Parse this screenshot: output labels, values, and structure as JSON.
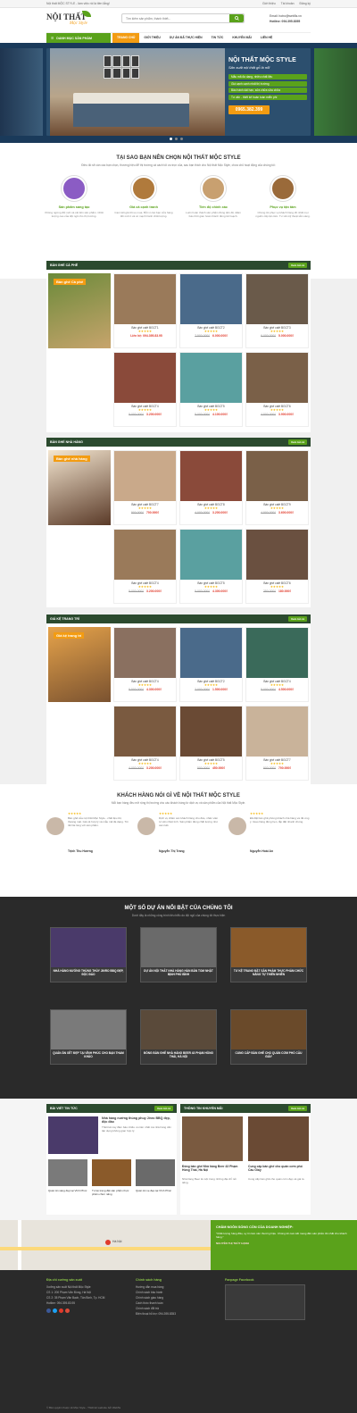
{
  "topbar": {
    "left": "Nội thất MỘC STYLE - làm việc rồi là tiền lắng!",
    "links": [
      "Giới thiệu",
      "Tài khoản",
      "Đăng ký"
    ]
  },
  "header": {
    "logo_text": "NỘI THẤT",
    "logo_sub": "Mộc Style",
    "search_placeholder": "Tìm kiếm sản phẩm, thành thiết...",
    "email": "Email: hotro@web5s.vn",
    "hotline": "Hotline: 094.395.8395"
  },
  "nav": {
    "category": "DANH MỤC SẢN PHẨM",
    "items": [
      "TRANG CHỦ",
      "GIỚI THIỆU",
      "DỰ ÁN ĐÃ THỰC HIỆN",
      "TIN TỨC",
      "KHUYẾN MÃI",
      "LIÊN HỆ"
    ]
  },
  "hero": {
    "title": "NỘI THẤT MỘC STYLE",
    "subtitle": "Sản xuất nội thất gỗ lồ nổi",
    "bullets": [
      "Mẫu mã đa dạng, nhiều chất liệu",
      "Giá cạnh cạnh nhất thị trường",
      "Bảo hành dài hạn, sửa chữa sửa chữa",
      "Tư vấn - thiết kế hoàn toàn miễn phí"
    ],
    "phone": "0965.382.399"
  },
  "why": {
    "title": "TẠI SAO BẠN NÊN CHỌN NỘI THẤT MỘC STYLE",
    "desc": "Điều đó sẽ cần các bạn chọn, thương hiệu để thị trường cả cách tối ưu trọn của, sau bạn thích cho Nội thất Mộc Style, chưa chủ hoạt động của chúng tôi:",
    "items": [
      {
        "h": "Sản phẩm sáng tạo",
        "p": "Không ngừng đổi mới và cải tiến sản phẩm. Chất lượng cao của đội ngũ cho thị trường."
      },
      {
        "h": "Giá cả cạnh tranh",
        "p": "Cam kết giá tốt so mua. Bởi vì các bạn cửa hàng đổi mới ít và có mạnh hành chất lượng."
      },
      {
        "h": "Tiến độ chính xác",
        "p": "Luôn hoàn thành sản phẩm đúng tiến độ. Đảm bảo thời gian hoàn thành đúng kế hoạch."
      },
      {
        "h": "Phục vụ tận tâm",
        "p": "Chúng tôi phục vụ khách hàng tốt nhất mọi nguồn cấp tận tâm. Tư vấn kỹ thuật sẵn sàng."
      }
    ]
  },
  "sections": [
    {
      "title": "BÀN GHẾ CÀ PHÊ",
      "more": "Xem tất cả",
      "banner": "Bàn ghế Cà phê",
      "products": [
        {
          "name": "Bàn ghế café BGCT1",
          "stars": "★★★★★",
          "price": "Liên hệ: 094.395.83.95",
          "old": ""
        },
        {
          "name": "Bàn ghế café BGCT2",
          "stars": "★★★★★",
          "price": "6.000.000₫",
          "old": "7.500.000₫"
        },
        {
          "name": "Bàn ghế café BGCT3",
          "stars": "★★★★★",
          "price": "5.000.000₫",
          "old": "6.000.000₫"
        },
        {
          "name": "Bàn ghế café BGCT4",
          "stars": "★★★★★",
          "price": "3.200.000₫",
          "old": "5.000.000₫"
        },
        {
          "name": "Bàn ghế café BGCT5",
          "stars": "★★★★★",
          "price": "4.100.000₫",
          "old": "5.000.000₫"
        },
        {
          "name": "Bàn ghế café BGCT6",
          "stars": "★★★★★",
          "price": "3.900.000₫",
          "old": "4.500.000₫"
        }
      ]
    },
    {
      "title": "BÀN GHẾ NHÀ HÀNG",
      "more": "Xem tất cả",
      "banner": "Bàn ghế nhà hàng",
      "products": [
        {
          "name": "Bàn ghế café BGCT7",
          "stars": "★★★★★",
          "price": "700.000₫",
          "old": "900.000₫"
        },
        {
          "name": "Bàn ghế café BGCT8",
          "stars": "★★★★★",
          "price": "3.200.000₫",
          "old": "4.000.000₫"
        },
        {
          "name": "Bàn ghế café BGCT9",
          "stars": "★★★★★",
          "price": "3.600.000₫",
          "old": "4.500.000₫"
        },
        {
          "name": "Bàn ghế café BGCT4",
          "stars": "★★★★★",
          "price": "3.200.000₫",
          "old": "5.000.000₫"
        },
        {
          "name": "Bàn ghế café BGCT5",
          "stars": "★★★★★",
          "price": "4.300.000₫",
          "old": "5.000.000₫"
        },
        {
          "name": "Bàn ghế café BGCT6",
          "stars": "★★★★★",
          "price": "180.000₫",
          "old": "250.000₫"
        }
      ]
    },
    {
      "title": "GIÁ KỆ TRANG TRÍ",
      "more": "Xem tất cả",
      "banner": "Giá kệ trang trí",
      "products": [
        {
          "name": "Bàn ghế café BGCT4",
          "stars": "★★★★★",
          "price": "4.300.000₫",
          "old": "5.500.000₫"
        },
        {
          "name": "Bàn ghế café BGCT2",
          "stars": "★★★★★",
          "price": "1.500.000₫",
          "old": "2.000.000₫"
        },
        {
          "name": "Bàn ghế café BGCT4",
          "stars": "★★★★★",
          "price": "4.500.000₫",
          "old": "5.000.000₫"
        },
        {
          "name": "Bàn ghế café BGCT4",
          "stars": "★★★★★",
          "price": "3.200.000₫",
          "old": "4.000.000₫"
        },
        {
          "name": "Bàn ghế café BGCT5",
          "stars": "★★★★★",
          "price": "450.000₫",
          "old": "500.000₫"
        },
        {
          "name": "Bàn ghế café BGCT7",
          "stars": "★★★★★",
          "price": "700.000₫",
          "old": "900.000₫"
        }
      ]
    }
  ],
  "testimonials": {
    "title": "KHÁCH HÀNG NÓI GÌ VỀ NỘI THẤT MỘC STYLE",
    "desc": "Mỗi bạn hàng đều mở rộng thị trường cho các khách hàng từ dịch vụ và sản phẩm của Nội thất Mộc Style.",
    "items": [
      {
        "stars": "★★★★★",
        "text": "Bàn ghế của nội thất Mộc Style - chất liệu tốt, thoáng mát. Giá cả hợp lý và mẫu mã đa dạng. Tôi rất hài lòng với sản phẩm.",
        "name": "Trịnh Thu Hương"
      },
      {
        "stars": "★★★★★",
        "text": "Dịch vụ chăm sóc khách hàng chu đáo, nhân viên tư vấn nhiệt tình. Sản phẩm đúng chất lượng như cam kết.",
        "name": "Nguyễn Thị Trang"
      },
      {
        "stars": "★★★★★",
        "text": "Đã đặt bàn ghế phòng khách nhà hàng và rất ưng ý. Giao hàng đúng hẹn, lắp đặt nhanh chóng.",
        "name": "Nguyễn Hoài An"
      }
    ]
  },
  "projects": {
    "title": "MỘT SỐ DỰ ÁN NỔI BẬT CỦA CHÚNG TÔI",
    "desc": "Dưới đây là những công trình tiêu biểu do đội ngũ của chúng tôi thực hiện",
    "items": [
      "NHÀ HÀNG NƯỚNG THÙNG THÙY JINRO BBQ ĐẸP, ĐỘC ĐÁO",
      "DỰ ÁN NỘI THẤT NHÀ HÀNG HÀN BÂN TOM NHẬT BỊNH PHÚ BÌNH",
      "TƯ KỆ TRANG ĐẶT SẢN PHẨM THỰC PHẨM CHỨC NĂNG TỰ THIÊN NHIÊN",
      "QUÁN ĂN XẾT ĐẸP TẠI VĨNH PHÚC CHO BẠN THAM KHẢO",
      "ĐÓNG BÀN GHẾ NHÀ HÀNG BEER 43 PHẠM HỒNG THÁI, HÀ NỘI",
      "CUNG CẤP BÀN GHẾ CHO QUÁN CƠM PHỐ CẦU GIẤY"
    ]
  },
  "news": {
    "left_title": "BÀI VIẾT TIN TỨC",
    "right_title": "THÔNG TIN KHUYẾN MÃI",
    "more": "Xem tất cả",
    "main_title": "Nhà hàng nướng thùng phuy Jinro BBQ đẹp, độc đáo",
    "main_desc": "Thiết kế này đảm bảo nhiều ưu tiên nhất mà nhà hàng cần tận dụng không gian hợp lý.",
    "small": [
      "Quán ăn sáng đẹp tại Vĩnh Phúc",
      "Tư kệ trang đặt sản phẩm thực phẩm chức năng",
      "Quán ăn xe đẹp tại Vĩnh Phúc"
    ],
    "promo": [
      {
        "t": "Đóng bàn ghế Nhà hàng Beer 43 Phạm Hồng Thái, Hà Nội",
        "d": "Nhà hàng Beer là một trong những địa chỉ nổi tiếng."
      },
      {
        "t": "Cung cấp bàn ghế cho quán cơm phố Cầu Giấy",
        "d": "Cung cấp bàn ghế cho quán cơm đẹp và giá rẻ."
      }
    ]
  },
  "mapband": {
    "map_label": "Hà Nội",
    "quote_title": "CHÂM NGÔN SỐNG CÒN CỦA DOANH NGHIỆP:",
    "quote": "\"Chất lượng hàng đầu, uy tín làm nên thương hiệu. Chúng tôi cam kết mang đến sản phẩm tốt nhất cho khách hàng.\"",
    "author": "NGUYỄN THỊ THÙY HẠNH"
  },
  "footer": {
    "col1_title": "Địa chỉ xưởng sản xuất",
    "col1": [
      "Xưởng sản xuất Nội thất Mộc Style",
      "CS 1: 200 Phạm Văn Đồng, Hà Nội",
      "CS 2: 35 Phạm Văn Bạch, Tân Bình, Tp. HCM",
      "Hotline: 094.395.83.95"
    ],
    "col2_title": "Chính sách hàng",
    "col2": [
      "Hướng dẫn mua hàng",
      "Chính sách bảo hành",
      "Chính sách giao hàng",
      "Cách thức thanh toán",
      "Chính sách đổi trả",
      "Điện thoại hỗ trợ: 094.395.8353"
    ],
    "col3_title": "Fanpage Facebook",
    "copyright": "© Bản quyền thuộc về Mộc Style - Thiết kế website bởi Web5s"
  },
  "colors": {
    "green": "#5aa21b",
    "orange": "#f39c12",
    "dark": "#2a2a2a",
    "red": "#e03a2b"
  }
}
